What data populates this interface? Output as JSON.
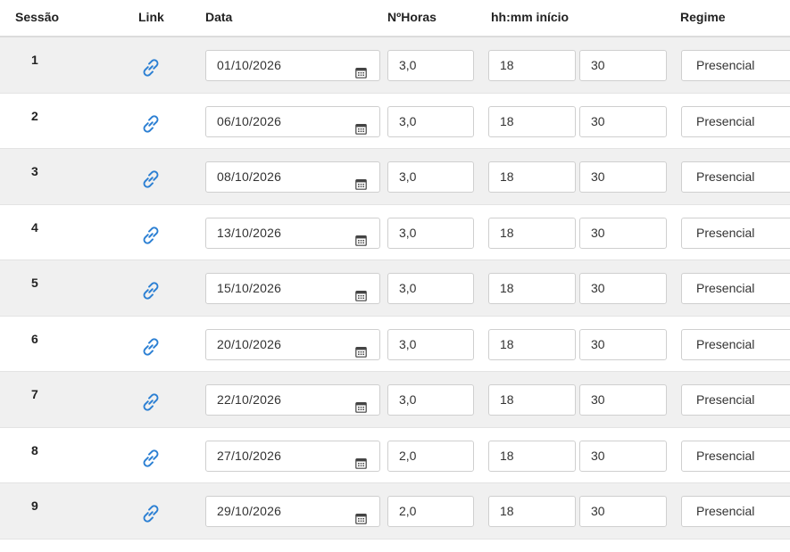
{
  "headers": {
    "sessao": "Sessão",
    "link": "Link",
    "data": "Data",
    "horas": "NºHoras",
    "inicio": "hh:mm início",
    "regime": "Regime"
  },
  "icons": {
    "link": "link-chain-icon",
    "calendar": "calendar-icon"
  },
  "colors": {
    "link_icon": "#2b7fd3",
    "stripe": "#f0f0f0"
  },
  "rows": [
    {
      "sessao": "1",
      "data": "01/10/2026",
      "horas": "3,0",
      "hh": "18",
      "mm": "30",
      "regime": "Presencial"
    },
    {
      "sessao": "2",
      "data": "06/10/2026",
      "horas": "3,0",
      "hh": "18",
      "mm": "30",
      "regime": "Presencial"
    },
    {
      "sessao": "3",
      "data": "08/10/2026",
      "horas": "3,0",
      "hh": "18",
      "mm": "30",
      "regime": "Presencial"
    },
    {
      "sessao": "4",
      "data": "13/10/2026",
      "horas": "3,0",
      "hh": "18",
      "mm": "30",
      "regime": "Presencial"
    },
    {
      "sessao": "5",
      "data": "15/10/2026",
      "horas": "3,0",
      "hh": "18",
      "mm": "30",
      "regime": "Presencial"
    },
    {
      "sessao": "6",
      "data": "20/10/2026",
      "horas": "3,0",
      "hh": "18",
      "mm": "30",
      "regime": "Presencial"
    },
    {
      "sessao": "7",
      "data": "22/10/2026",
      "horas": "3,0",
      "hh": "18",
      "mm": "30",
      "regime": "Presencial"
    },
    {
      "sessao": "8",
      "data": "27/10/2026",
      "horas": "2,0",
      "hh": "18",
      "mm": "30",
      "regime": "Presencial"
    },
    {
      "sessao": "9",
      "data": "29/10/2026",
      "horas": "2,0",
      "hh": "18",
      "mm": "30",
      "regime": "Presencial"
    }
  ]
}
